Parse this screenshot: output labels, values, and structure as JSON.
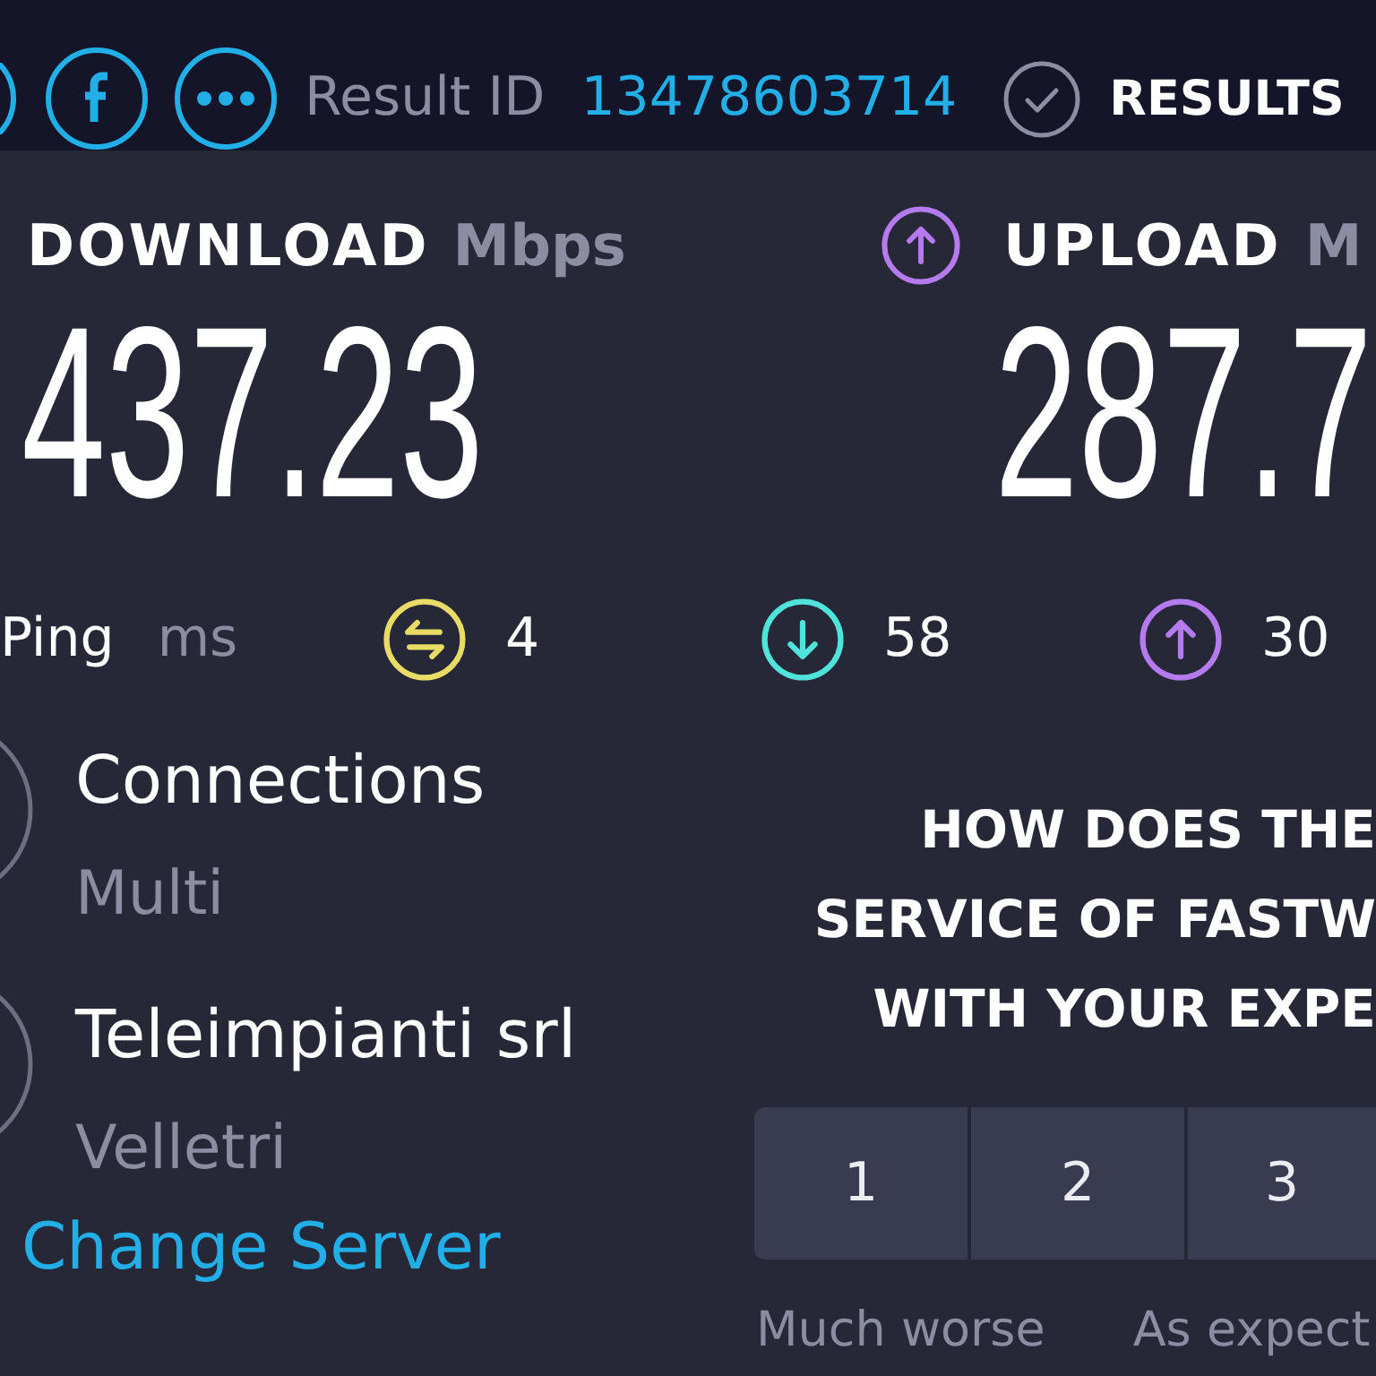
{
  "header": {
    "result_id_label": "Result ID",
    "result_id": "13478603714",
    "results_link": "RESULTS"
  },
  "download": {
    "label": "DOWNLOAD",
    "unit": "Mbps",
    "value": "437.23"
  },
  "upload": {
    "label": "UPLOAD",
    "unit": "M",
    "value": "287.7"
  },
  "ping": {
    "label": "Ping",
    "unit": "ms",
    "latencies": [
      {
        "kind": "idle",
        "value": "4"
      },
      {
        "kind": "download",
        "value": "58"
      },
      {
        "kind": "upload",
        "value": "30"
      }
    ]
  },
  "server_info": [
    {
      "title": "Connections",
      "subtitle": "Multi"
    },
    {
      "title": "Teleimpianti srl",
      "subtitle": "Velletri"
    }
  ],
  "change_server_link": "Change Server",
  "survey": {
    "question_lines": [
      "HOW DOES THE",
      "SERVICE OF FASTW",
      "WITH YOUR EXPE"
    ],
    "options": [
      {
        "label": "1",
        "selected": false
      },
      {
        "label": "2",
        "selected": false
      },
      {
        "label": "3",
        "selected": false
      }
    ],
    "scale_labels": [
      "Much worse",
      "As expect"
    ]
  }
}
